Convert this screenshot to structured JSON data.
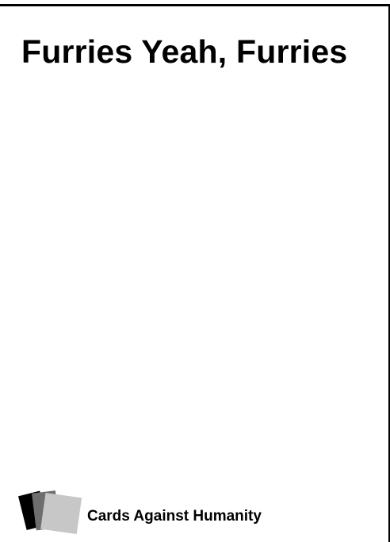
{
  "card": {
    "text": "Furries Yeah, Furries",
    "brand_name": "Cards Against Humanity",
    "logo_icon": "stacked-cards-icon",
    "colors": {
      "background": "#ffffff",
      "text": "#000000",
      "logo_back": "#000000",
      "logo_middle": "#6e6e6e",
      "logo_front": "#c7c7c7"
    }
  }
}
